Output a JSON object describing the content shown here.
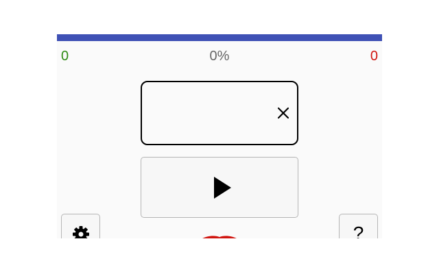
{
  "scoreboard": {
    "correct_count": "0",
    "progress_text": "0%",
    "wrong_count": "0",
    "correct_color": "#2e8b13",
    "wrong_color": "#d0140e"
  },
  "answer": {
    "value": "",
    "clear_icon": "close-icon"
  },
  "controls": {
    "play_icon": "play-icon",
    "settings_icon": "gear-icon",
    "help_label": "?"
  },
  "colors": {
    "accent": "#3f51b5",
    "background": "#fafafa",
    "mascot": "#d0140e"
  }
}
